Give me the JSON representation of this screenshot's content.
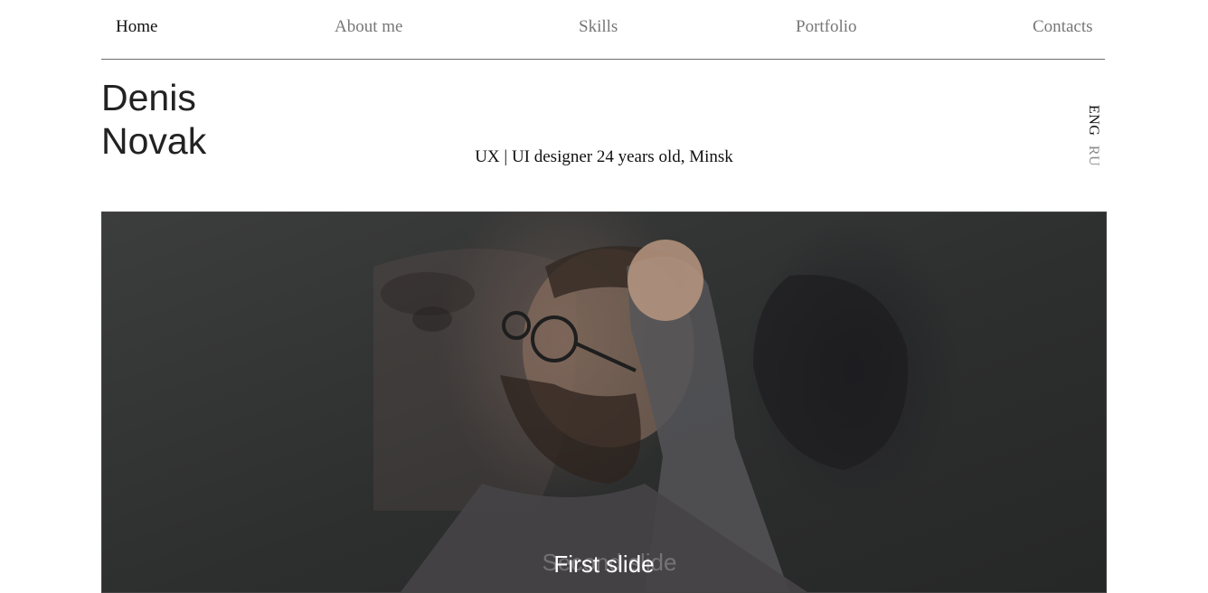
{
  "nav": {
    "items": [
      {
        "label": "Home",
        "active": true
      },
      {
        "label": "About me",
        "active": false
      },
      {
        "label": "Skills",
        "active": false
      },
      {
        "label": "Portfolio",
        "active": false
      },
      {
        "label": "Contacts",
        "active": false
      }
    ]
  },
  "header": {
    "first_name": "Denis",
    "last_name": "Novak",
    "tagline": "UX | UI designer 24 years old, Minsk"
  },
  "language": {
    "options": [
      "ENG",
      "RU"
    ],
    "selected": "ENG"
  },
  "slider": {
    "caption": "First slide",
    "caption_behind": "Second slide"
  }
}
